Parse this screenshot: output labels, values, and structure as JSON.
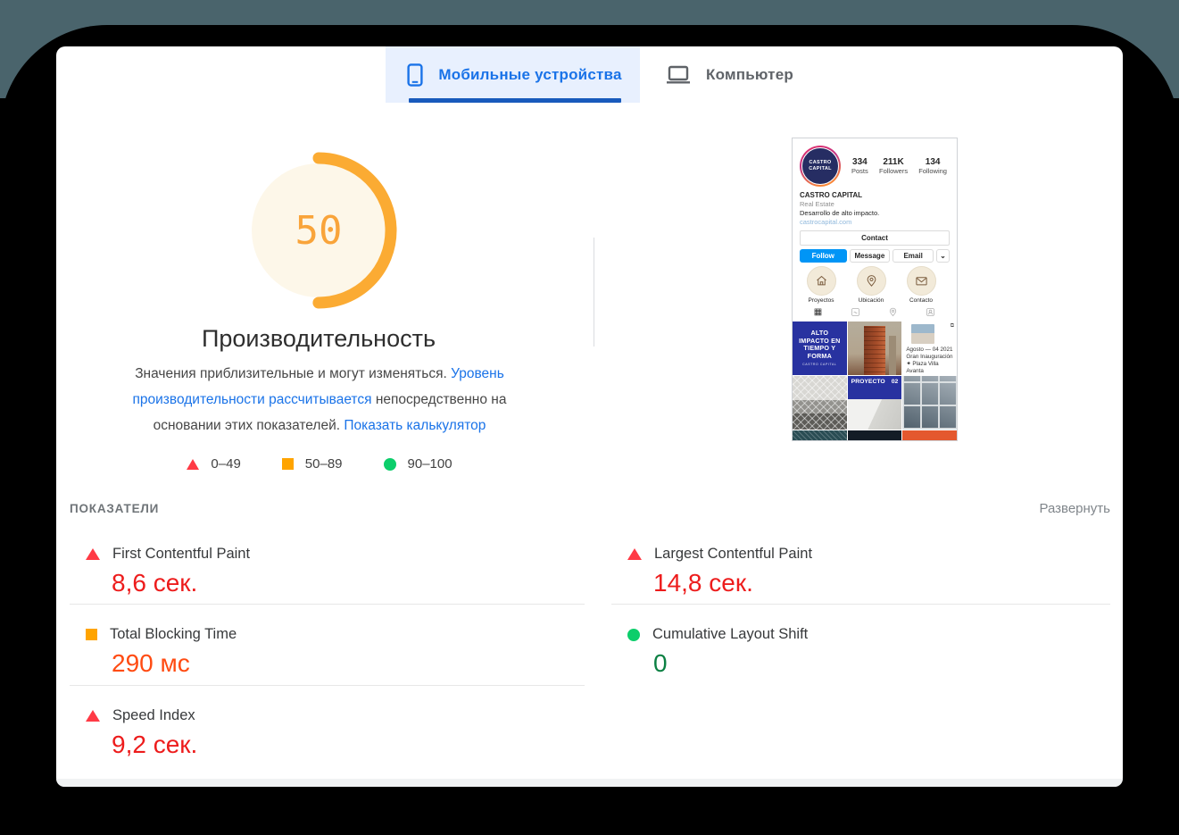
{
  "window": {
    "background": "#000000",
    "top_strip_color": "#4a646c"
  },
  "tabs": {
    "mobile": {
      "label": "Мобильные устройства",
      "active": true
    },
    "desktop": {
      "label": "Компьютер",
      "active": false
    }
  },
  "performance": {
    "score": "50",
    "title": "Производительность",
    "description": {
      "part1": "Значения приблизительные и могут изменяться.",
      "link1": "Уровень производительности рассчитывается",
      "part2": "непосредственно на основании этих показателей.",
      "link2": "Показать калькулятор"
    },
    "legend": [
      {
        "shape": "triangle",
        "color": "#ff3a45",
        "range": "0–49"
      },
      {
        "shape": "square",
        "color": "#ffa400",
        "range": "50–89"
      },
      {
        "shape": "circle",
        "color": "#0cce6b",
        "range": "90–100"
      }
    ],
    "score_colors": {
      "arc": "#fbab33",
      "background": "#fdf7e9",
      "text": "#f9a43a"
    }
  },
  "metrics": {
    "section_title": "ПОКАЗАТЕЛИ",
    "expand_label": "Развернуть",
    "left": [
      {
        "icon": "triangle",
        "name": "First Contentful Paint",
        "value": "8,6 сек.",
        "value_color": "#ed1c1c"
      },
      {
        "icon": "square",
        "name": "Total Blocking Time",
        "value": "290 мс",
        "value_color": "#ff4b12"
      },
      {
        "icon": "triangle",
        "name": "Speed Index",
        "value": "9,2 сек.",
        "value_color": "#ed1c1c"
      }
    ],
    "right": [
      {
        "icon": "triangle",
        "name": "Largest Contentful Paint",
        "value": "14,8 сек.",
        "value_color": "#ed1c1c"
      },
      {
        "icon": "circle",
        "name": "Cumulative Layout Shift",
        "value": "0",
        "value_color": "#0b8043"
      }
    ]
  },
  "preview": {
    "avatar_text": "CASTRO CAPITAL",
    "stats": [
      {
        "value": "334",
        "label": "Posts"
      },
      {
        "value": "211K",
        "label": "Followers"
      },
      {
        "value": "134",
        "label": "Following"
      }
    ],
    "name": "CASTRO CAPITAL",
    "category": "Real Estate",
    "bio": "Desarrollo de alto impacto.",
    "website": "castrocapital.com",
    "contact_label": "Contact",
    "follow_label": "Follow",
    "message_label": "Message",
    "email_label": "Email",
    "highlights": [
      {
        "icon": "house-icon",
        "label": "Proyectos"
      },
      {
        "icon": "pin-icon",
        "label": "Ubicación"
      },
      {
        "icon": "envelope-icon",
        "label": "Contacto"
      }
    ],
    "grid": {
      "tile1": {
        "title": "ALTO IMPACTO EN TIEMPO Y FORMA",
        "footer": "CASTRO CAPITAL"
      },
      "tile3": {
        "line1": "Agosto — 04 2021",
        "line2": "Gran Inauguración",
        "line3": "✦ Plaza Villa Avanta"
      },
      "tile5": {
        "title": "PROYECTO",
        "number": "02"
      }
    }
  },
  "icons": {
    "carousel": "⧉",
    "chevron_down": "⌄",
    "grid_glyph": "▦"
  }
}
